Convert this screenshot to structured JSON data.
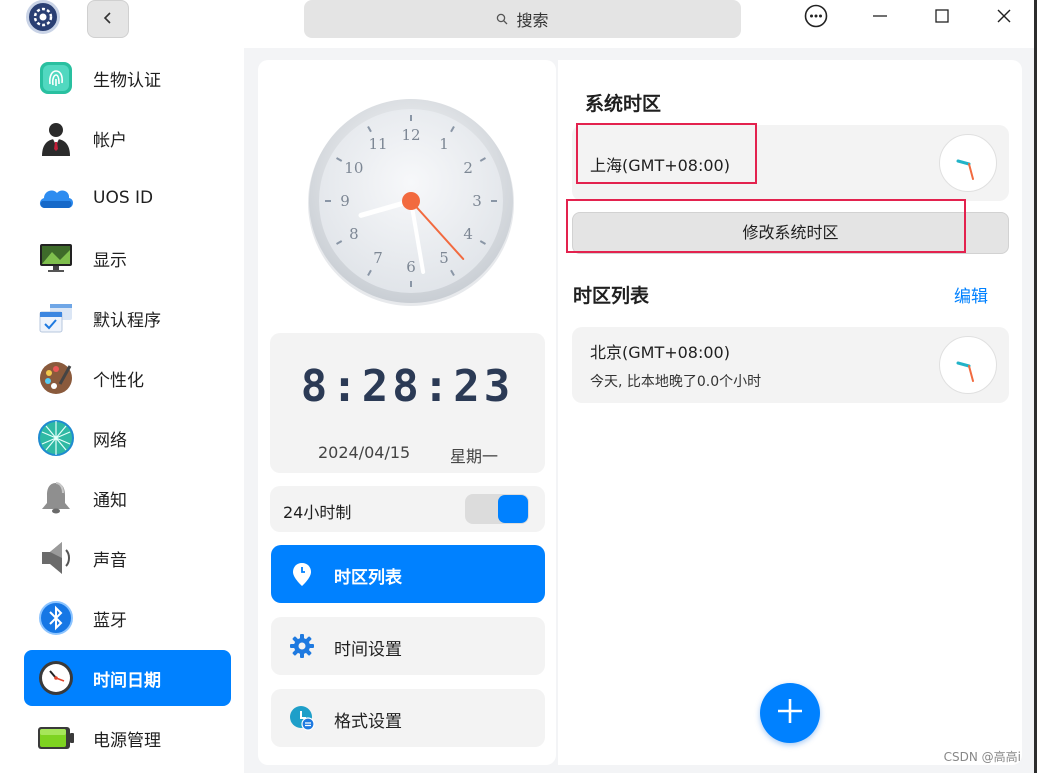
{
  "titlebar": {
    "search_placeholder": "搜索",
    "icons": [
      "app-logo-icon",
      "back-arrow-icon",
      "search-icon",
      "more-icon",
      "minimize-icon",
      "maximize-icon",
      "close-icon"
    ]
  },
  "sidebar": {
    "items": [
      {
        "label": "生物认证",
        "icon": "fingerprint-icon"
      },
      {
        "label": "帐户",
        "icon": "account-icon"
      },
      {
        "label": "UOS ID",
        "icon": "cloud-icon"
      },
      {
        "label": "显示",
        "icon": "display-icon"
      },
      {
        "label": "默认程序",
        "icon": "default-apps-icon"
      },
      {
        "label": "个性化",
        "icon": "palette-icon"
      },
      {
        "label": "网络",
        "icon": "network-icon"
      },
      {
        "label": "通知",
        "icon": "bell-icon"
      },
      {
        "label": "声音",
        "icon": "speaker-icon"
      },
      {
        "label": "蓝牙",
        "icon": "bluetooth-icon"
      },
      {
        "label": "时间日期",
        "icon": "clock-icon",
        "active": true
      },
      {
        "label": "电源管理",
        "icon": "battery-icon"
      }
    ]
  },
  "middle": {
    "analog_clock": {
      "numerals": [
        "12",
        "1",
        "2",
        "3",
        "4",
        "5",
        "6",
        "7",
        "8",
        "9",
        "10",
        "11"
      ],
      "hour": 8,
      "minute": 28,
      "second": 23
    },
    "digital_time": "8:28:23",
    "date": "2024/04/15",
    "weekday": "星期一",
    "format_24h_label": "24小时制",
    "format_24h_on": true,
    "menu": [
      {
        "label": "时区列表",
        "icon": "location-pin-icon",
        "active": true
      },
      {
        "label": "时间设置",
        "icon": "gear-icon"
      },
      {
        "label": "格式设置",
        "icon": "format-clock-icon"
      }
    ]
  },
  "right": {
    "system_tz_title": "系统时区",
    "system_tz_name": "上海(GMT+08:00)",
    "change_tz_button": "修改系统时区",
    "tz_list_title": "时区列表",
    "edit_label": "编辑",
    "tz_list": [
      {
        "name": "北京(GMT+08:00)",
        "desc": "今天, 比本地晚了0.0个小时"
      }
    ]
  },
  "colors": {
    "accent": "#0081ff",
    "highlight": "#e3224e",
    "panel": "#f3f3f3"
  },
  "watermark": "CSDN @高高i"
}
